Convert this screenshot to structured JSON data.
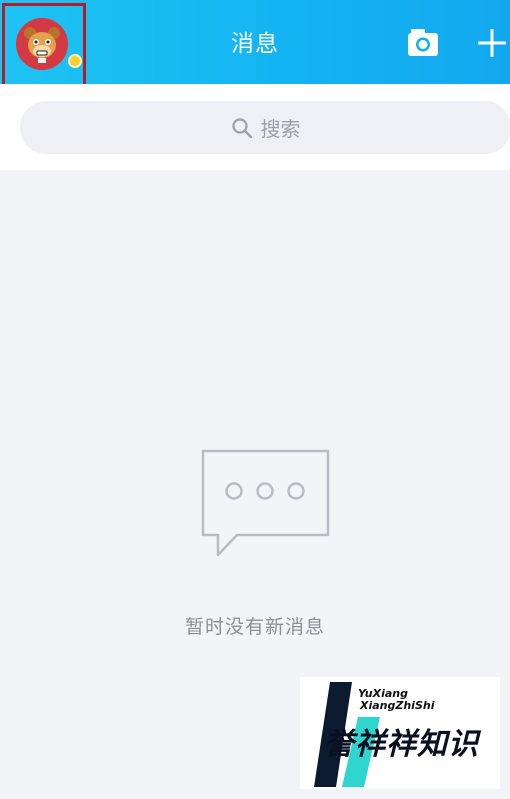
{
  "header": {
    "title": "消息",
    "avatar_icon": "bear-avatar-icon",
    "camera_icon": "camera-icon",
    "add_icon": "plus-icon",
    "background_color": "#14b4f2"
  },
  "search": {
    "placeholder": "搜索",
    "icon": "search-icon"
  },
  "empty_state": {
    "icon": "chat-bubble-icon",
    "message": "暂时没有新消息"
  },
  "watermark": {
    "line1": "YuXiang",
    "line2": "XiangZhiShi",
    "cn_text": "誉祥祥知识"
  },
  "colors": {
    "accent": "#14b4f2",
    "highlight_box": "#b11e2b",
    "background": "#f3f4f8"
  }
}
